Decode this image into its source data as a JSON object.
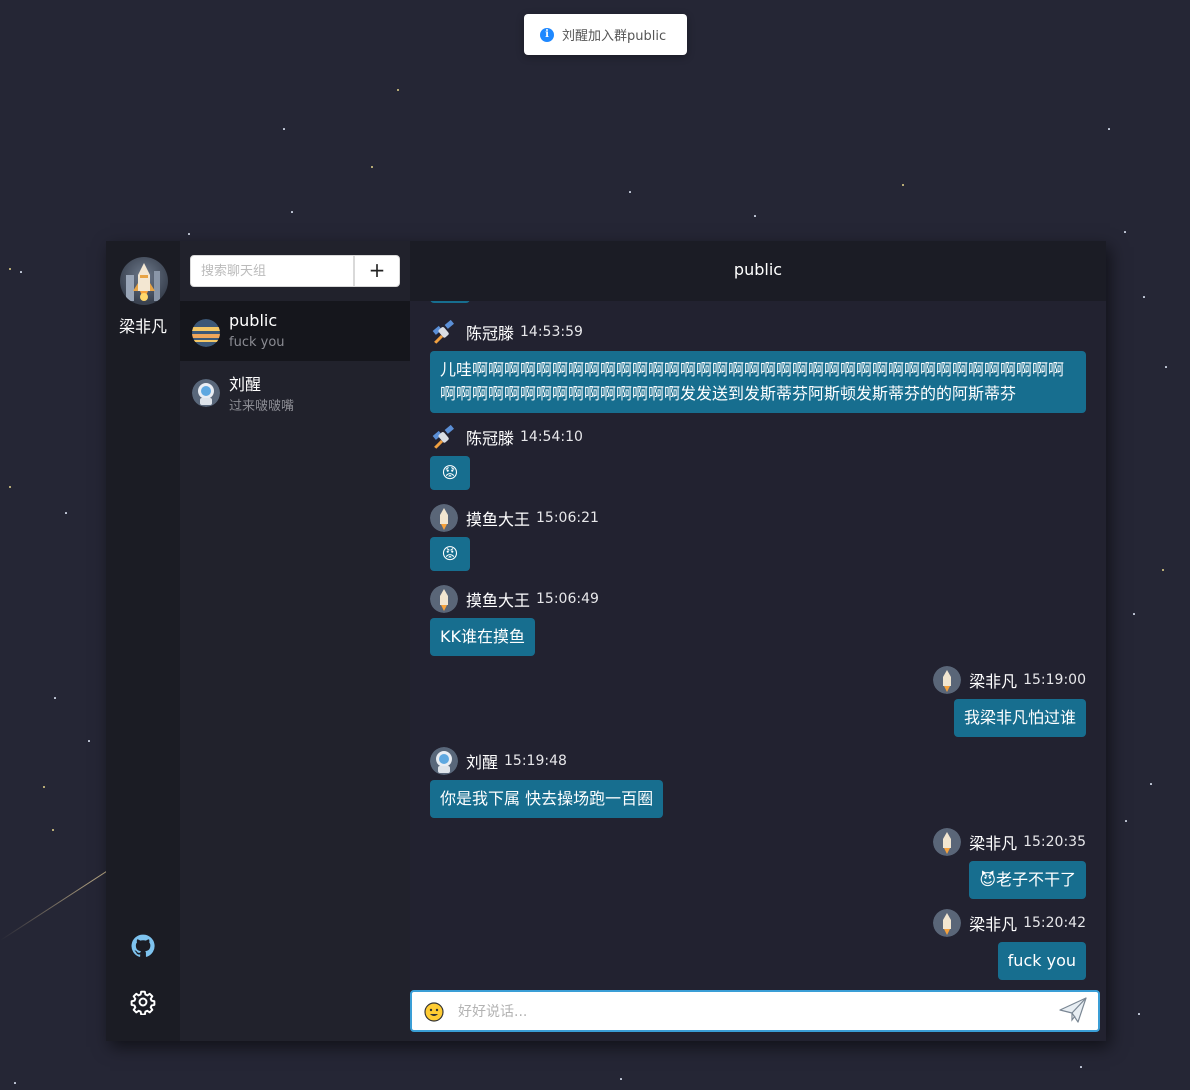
{
  "toast": {
    "icon": "info-icon",
    "text": "刘醒加入群public"
  },
  "user": {
    "name": "梁非凡"
  },
  "nav": {
    "github_icon": "github-icon",
    "settings_icon": "gear-icon"
  },
  "sidebar": {
    "search_placeholder": "搜索聊天组",
    "add_label": "+",
    "rooms": [
      {
        "name": "public",
        "last_message": "fuck you",
        "active": true
      },
      {
        "name": "刘醒",
        "last_message": "过来啵啵嘴",
        "active": false
      }
    ]
  },
  "chat": {
    "title": "public",
    "messages": [
      {
        "user": "陈冠滕",
        "time": "14:53:59",
        "text": "儿哇啊啊啊啊啊啊啊啊啊啊啊啊啊啊啊啊啊啊啊啊啊啊啊啊啊啊啊啊啊啊啊啊啊啊啊啊啊啊啊啊啊啊啊啊啊啊啊啊啊啊啊啊发发送到发斯蒂芬阿斯顿发斯蒂芬的的阿斯蒂芬",
        "side": "left"
      },
      {
        "user": "陈冠滕",
        "time": "14:54:10",
        "text": "😟",
        "side": "left"
      },
      {
        "user": "摸鱼大王",
        "time": "15:06:21",
        "text": "😡",
        "side": "left"
      },
      {
        "user": "摸鱼大王",
        "time": "15:06:49",
        "text": "KK谁在摸鱼",
        "side": "left"
      },
      {
        "user": "梁非凡",
        "time": "15:19:00",
        "text": "我梁非凡怕过谁",
        "side": "right"
      },
      {
        "user": "刘醒",
        "time": "15:19:48",
        "text": "你是我下属 快去操场跑一百圈",
        "side": "left"
      },
      {
        "user": "梁非凡",
        "time": "15:20:35",
        "text": "😈老子不干了",
        "side": "right"
      },
      {
        "user": "梁非凡",
        "time": "15:20:42",
        "text": "fuck you",
        "side": "right"
      }
    ],
    "input_placeholder": "好好说话...",
    "emoji_icon": "smiley-icon",
    "send_icon": "paper-plane-icon"
  },
  "colors": {
    "bubble": "#176e8f",
    "background": "#252635",
    "nav": "#1b1c24",
    "input_border": "#3a9ed6"
  }
}
